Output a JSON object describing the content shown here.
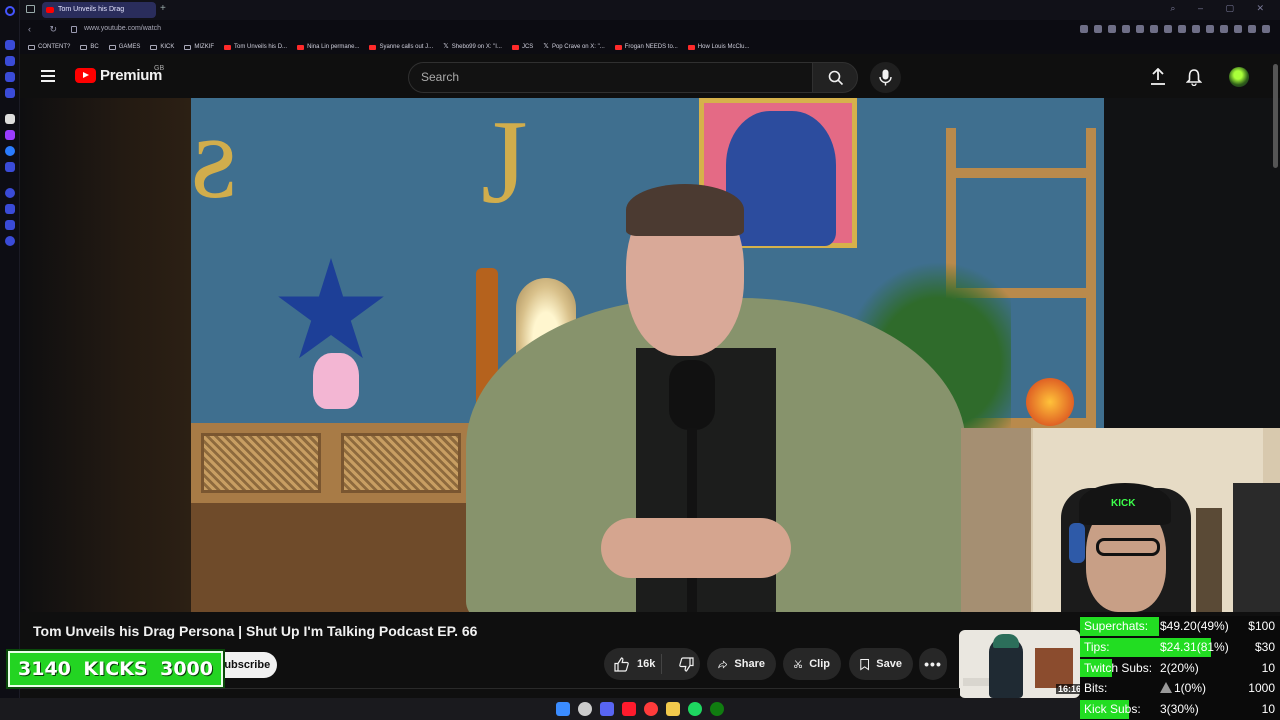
{
  "browser": {
    "tab_title": "Tom Unveils his Drag",
    "url": "www.youtube.com/watch",
    "bookmarks": [
      {
        "label": "CONTENT?",
        "icon": "folder-icon"
      },
      {
        "label": "BC",
        "icon": "folder-icon"
      },
      {
        "label": "GAMES",
        "icon": "folder-icon"
      },
      {
        "label": "KICK",
        "icon": "folder-icon"
      },
      {
        "label": "MIZKIF",
        "icon": "folder-icon"
      },
      {
        "label": "Tom Unveils his D...",
        "icon": "youtube-icon"
      },
      {
        "label": "Nina Lin permane...",
        "icon": "youtube-icon"
      },
      {
        "label": "Syanne calls out J...",
        "icon": "youtube-icon"
      },
      {
        "label": "Shebo99 on X: \"I...",
        "icon": "x-icon"
      },
      {
        "label": "JCS",
        "icon": "youtube-icon"
      },
      {
        "label": "Pop Crave on X: \"...",
        "icon": "x-icon"
      },
      {
        "label": "Frogan NEEDS to...",
        "icon": "youtube-icon"
      },
      {
        "label": "How Louis McClu...",
        "icon": "youtube-icon"
      }
    ]
  },
  "youtube": {
    "logo_text": "Premium",
    "region": "GB",
    "search_placeholder": "Search",
    "video_title": "Tom Unveils his Drag Persona | Shut Up I'm Talking Podcast EP. 66",
    "subscribe_label": "Subscribe",
    "like_count": "16k",
    "share_label": "Share",
    "clip_label": "Clip",
    "save_label": "Save",
    "more_label": "•••"
  },
  "webcam": {
    "cap_text": "KICK"
  },
  "kicks_overlay": {
    "current": "3140",
    "label": "KICKS",
    "goal": "3000"
  },
  "miniplayer": {
    "time": "16:16"
  },
  "goals": [
    {
      "label": "Superchats:",
      "value": "$49.20(49%)",
      "target": "$100",
      "progress": 0.49
    },
    {
      "label": "Tips:",
      "value": "$24.31(81%)",
      "target": "$30",
      "progress": 0.81
    },
    {
      "label": "Twitch Subs:",
      "value": "2(20%)",
      "target": "10",
      "progress": 0.2
    },
    {
      "label": "Bits:",
      "value": "1(0%)",
      "target": "1000",
      "progress": 0.0
    },
    {
      "label": "Kick Subs:",
      "value": "3(30%)",
      "target": "10",
      "progress": 0.3
    }
  ],
  "colors": {
    "goal_fill": "#22dd22",
    "kicks_bg": "#23d422",
    "youtube_red": "#ff0000"
  }
}
